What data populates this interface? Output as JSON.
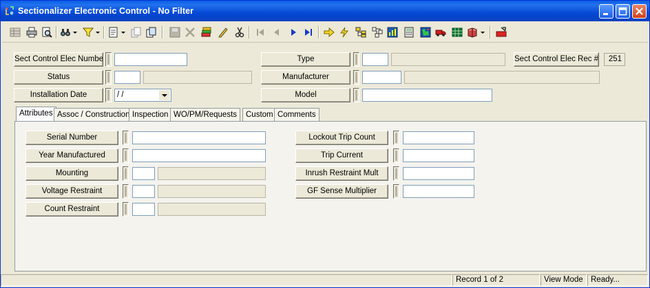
{
  "window": {
    "title": "Sectionalizer Electronic Control - No Filter",
    "controls": [
      "minimize-icon",
      "maximize-icon",
      "close-icon"
    ]
  },
  "toolbar": {
    "icons": [
      "grid-icon",
      "print-icon",
      "print-preview-icon",
      "binoculars-icon",
      "filter-icon",
      "new-record-icon",
      "copy-record-icon",
      "clone-icon",
      "save-icon",
      "delete-icon",
      "books-icon",
      "edit-pencil-icon",
      "scissors-icon",
      "first-record-icon",
      "previous-record-icon",
      "next-record-icon",
      "last-record-icon",
      "arrow-right-icon",
      "lightning-icon",
      "hierarchy-icon",
      "tree-icon",
      "chart-icon",
      "calculator-icon",
      "map-icon",
      "truck-icon",
      "spreadsheet-icon",
      "book-icon",
      "exit-icon"
    ]
  },
  "header": {
    "sect_control_elec_number": {
      "label": "Sect Control Elec Number",
      "value": ""
    },
    "status": {
      "label": "Status",
      "code": "",
      "description": ""
    },
    "installation_date": {
      "label": "Installation Date",
      "value": " / /"
    },
    "type": {
      "label": "Type",
      "code": "",
      "description": ""
    },
    "manufacturer": {
      "label": "Manufacturer",
      "code": "",
      "description": ""
    },
    "model": {
      "label": "Model",
      "value": ""
    },
    "rec_number": {
      "label": "Sect Control Elec Rec #",
      "value": "251"
    }
  },
  "tabs": [
    "Attributes",
    "Assoc / Construction",
    "Inspection",
    "WO/PM/Requests",
    "Custom",
    "Comments"
  ],
  "active_tab": "Attributes",
  "attributes": {
    "serial_number": {
      "label": "Serial Number",
      "value": ""
    },
    "year_manufactured": {
      "label": "Year Manufactured",
      "value": ""
    },
    "mounting": {
      "label": "Mounting",
      "code": "",
      "description": ""
    },
    "voltage_restraint": {
      "label": "Voltage Restraint",
      "code": "",
      "description": ""
    },
    "count_restraint": {
      "label": "Count Restraint",
      "code": "",
      "description": ""
    },
    "lockout_trip_count": {
      "label": "Lockout Trip Count",
      "value": ""
    },
    "trip_current": {
      "label": "Trip Current",
      "value": ""
    },
    "inrush_restraint_mult": {
      "label": "Inrush Restraint Mult",
      "value": ""
    },
    "gf_sense_multiplier": {
      "label": "GF Sense Multiplier",
      "value": ""
    }
  },
  "statusbar": {
    "record": "Record 1 of 2",
    "mode": "View Mode",
    "state": "Ready..."
  }
}
